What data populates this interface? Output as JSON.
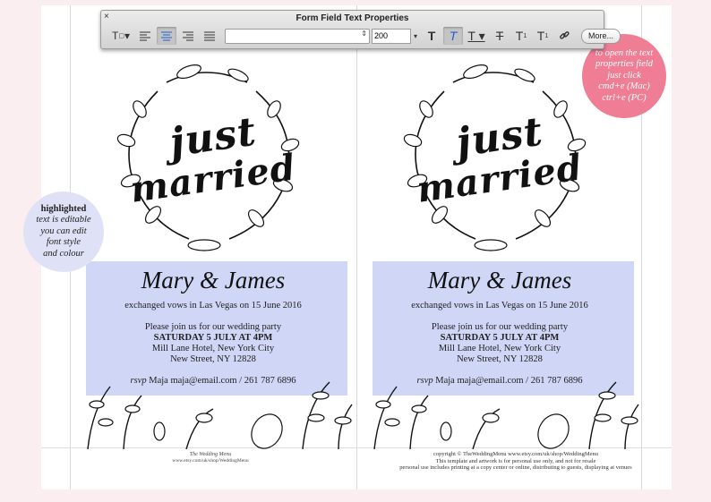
{
  "toolbar": {
    "title": "Form Field Text Properties",
    "close": "×",
    "font_size": "200",
    "more_label": "More..."
  },
  "tip_right": {
    "lines": [
      "to open the text",
      "properties field",
      "just click",
      "cmd+e (Mac)",
      "ctrl+e (PC)"
    ]
  },
  "tip_left": {
    "bold": "highlighted",
    "lines": [
      "text is editable",
      "you can edit",
      "font style",
      "and colour"
    ]
  },
  "card": {
    "headline_1": "just",
    "headline_2": "married",
    "names": "Mary & James",
    "vows": "exchanged vows in Las Vegas on 15 June 2016",
    "invite": "Please join us for our wedding party",
    "date": "SATURDAY 5 JULY AT 4PM",
    "venue": "Mill Lane Hotel, New York City",
    "street": "New Street, NY 12828",
    "rsvp_label": "rsvp",
    "rsvp": "Maja maja@email.com / 261 787 6896"
  },
  "footer_left": {
    "brand": "The Wedding Menu",
    "url": "www.etsy.com/uk/shop/WeddingMenu"
  },
  "footer_right": {
    "line1": "copyright © TheWeddingMenu www.etsy.com/uk/shop/WeddingMenu",
    "line2": "This template and artwork is for personal use only, and not for resale",
    "line3": "personal use includes printing at a copy center or online, distributing to guests, displaying at venues"
  },
  "colors": {
    "panel": "#cfd6f6",
    "tip_right_bg": "#ef7d93",
    "tip_left_bg": "#dfe2f7",
    "page_bg": "#fbeef0"
  }
}
